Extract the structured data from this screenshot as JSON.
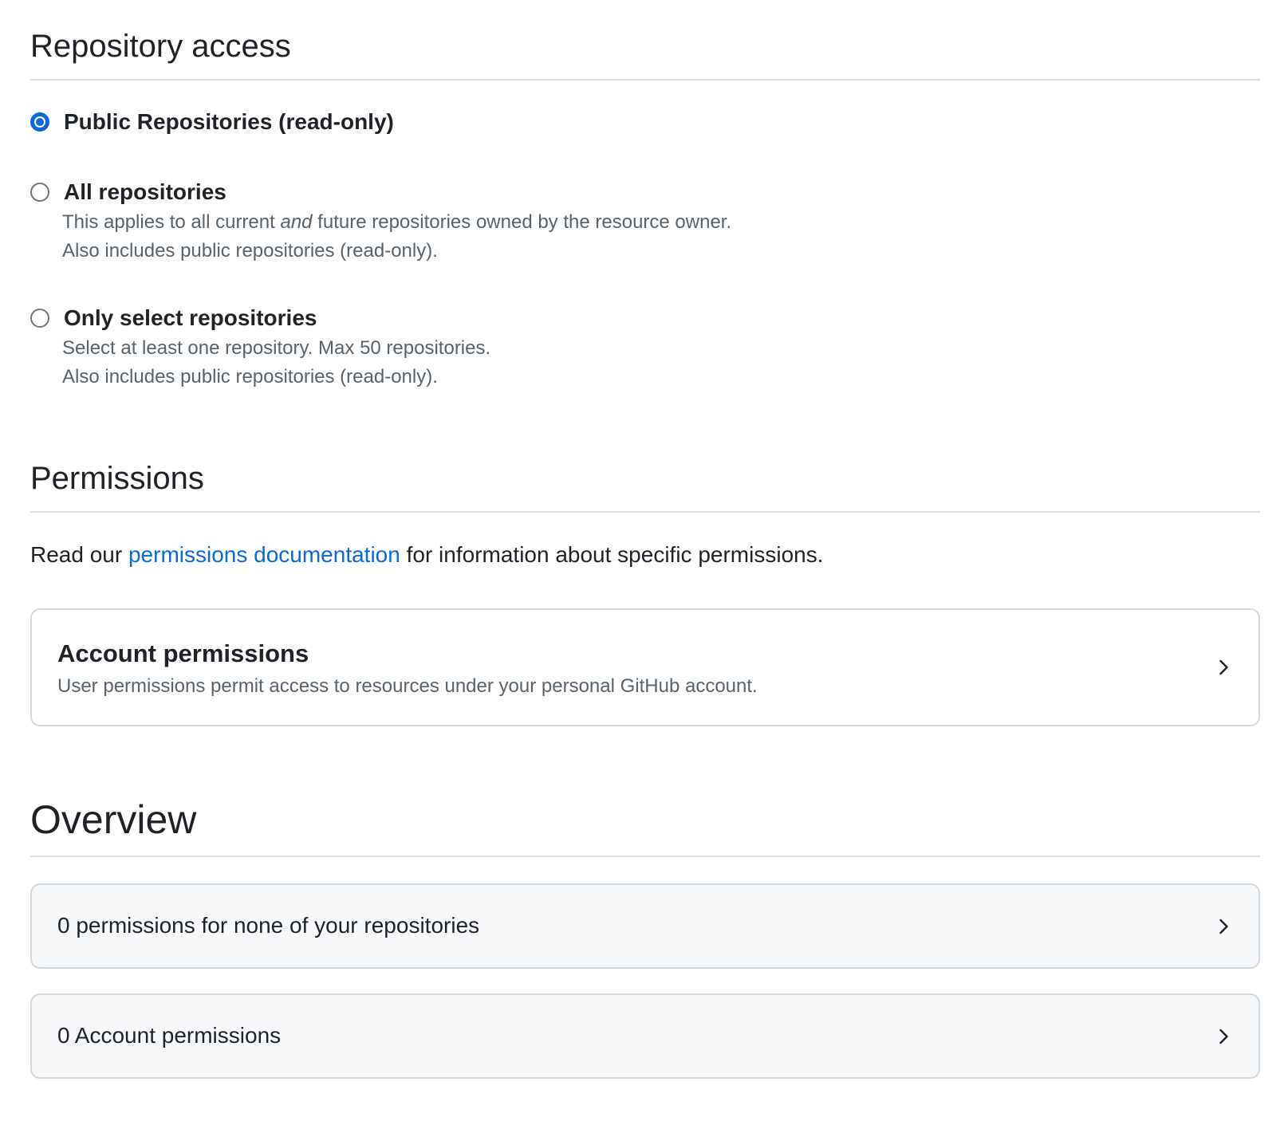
{
  "repository_access": {
    "title": "Repository access",
    "options": [
      {
        "label": "Public Repositories (read-only)",
        "checked": true
      },
      {
        "label": "All repositories",
        "checked": false,
        "desc_line1_pre": "This applies to all current ",
        "desc_line1_em": "and",
        "desc_line1_post": " future repositories owned by the resource owner.",
        "desc_line2": "Also includes public repositories (read-only)."
      },
      {
        "label": "Only select repositories",
        "checked": false,
        "desc_line1": "Select at least one repository. Max 50 repositories.",
        "desc_line2": "Also includes public repositories (read-only)."
      }
    ]
  },
  "permissions": {
    "title": "Permissions",
    "intro_pre": "Read our ",
    "intro_link": "permissions documentation",
    "intro_post": " for information about specific permissions.",
    "account_card": {
      "title": "Account permissions",
      "description": "User permissions permit access to resources under your personal GitHub account.",
      "icon": "chevron-right-icon"
    }
  },
  "overview": {
    "title": "Overview",
    "items": [
      {
        "label": "0 permissions for none of your repositories",
        "icon": "chevron-right-icon"
      },
      {
        "label": "0 Account permissions",
        "icon": "chevron-right-icon"
      }
    ]
  },
  "colors": {
    "accent": "#0969da",
    "text": "#1f2328",
    "muted_text": "#59636e",
    "border": "#d1d9e0",
    "muted_bg": "#f6f8fa"
  }
}
